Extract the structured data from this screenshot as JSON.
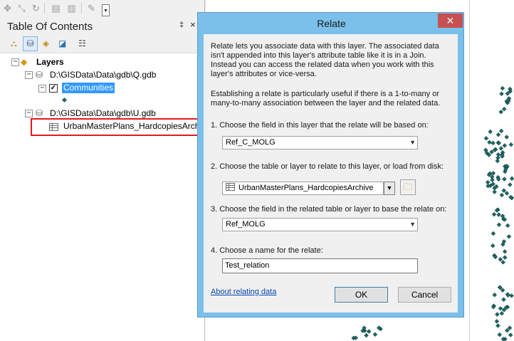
{
  "toolbar": {
    "icons": [
      "pan-icon",
      "identify-icon",
      "refresh-icon",
      "table-icon",
      "layout-icon",
      "editor-icon"
    ]
  },
  "toc": {
    "title": "Table Of Contents",
    "pin_glyph": "‡",
    "close_glyph": "×",
    "tree": {
      "layers_label": "Layers",
      "db1_path": "D:\\GISData\\Data\\gdb\\Q.gdb",
      "layer1_label": "Communities",
      "layer1_checked": true,
      "db2_path": "D:\\GISData\\Data\\gdb\\U.gdb",
      "table_label": "UrbanMasterPlans_HardcopiesArch"
    }
  },
  "dialog": {
    "title": "Relate",
    "close_glyph": "✕",
    "intro": "Relate lets you associate data with this layer. The associated data isn't appended into this layer's attribute table like it is in a Join. Instead you can access the related data when you work with this layer's attributes or vice-versa.",
    "intro2": "Establishing a relate is particularly useful if there is a 1-to-many or many-to-many association between the layer and the related data.",
    "step1_label": "1. Choose the field in this layer that the relate will be based on:",
    "step1_value": "Ref_C_MOLG",
    "step2_label": "2. Choose the table or layer to relate to this layer, or load from disk:",
    "step2_value": "UrbanMasterPlans_HardcopiesArchive",
    "step3_label": "3. Choose the field in the related table or layer to base the relate on:",
    "step3_value": "Ref_MOLG",
    "step4_label": "4. Choose a name for the relate:",
    "step4_value": "Test_relation",
    "about_link": "About relating data",
    "ok_label": "OK",
    "cancel_label": "Cancel"
  },
  "colors": {
    "dialog_frame": "#7ac0ea",
    "close_button": "#c75050",
    "selection": "#3399ff",
    "annotation_red": "#e21b1b",
    "map_symbol": "#1e6a6a"
  }
}
